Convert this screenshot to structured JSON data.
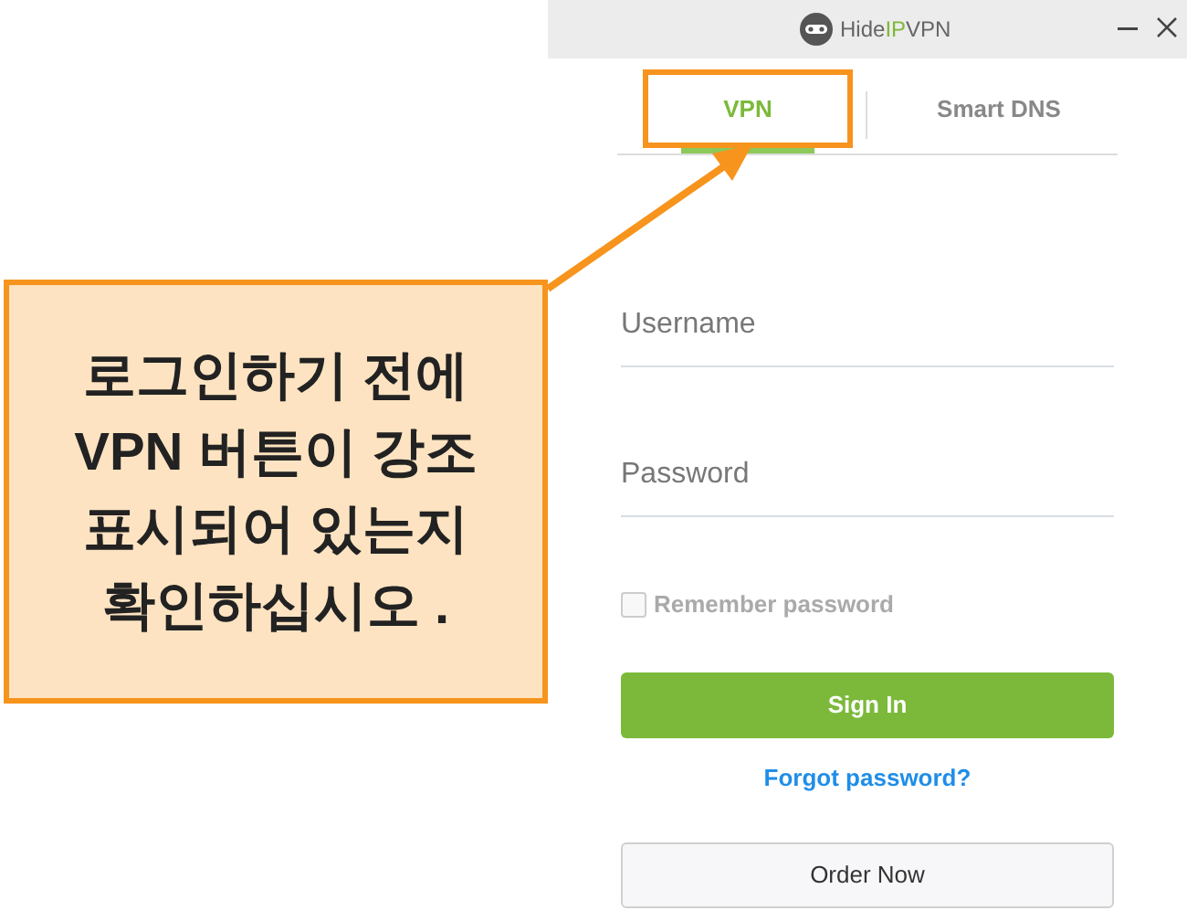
{
  "window": {
    "logo": {
      "before": "Hide",
      "highlight": "IP",
      "after": "VPN"
    }
  },
  "tabs": [
    {
      "label": "VPN",
      "selected": true,
      "highlighted": true
    },
    {
      "label": "Smart DNS",
      "selected": false,
      "highlighted": false
    }
  ],
  "form": {
    "username": {
      "placeholder": "Username"
    },
    "password": {
      "placeholder": "Password"
    },
    "remember": {
      "label": "Remember password",
      "checked": false
    },
    "sign_in": "Sign In",
    "forgot": "Forgot password?",
    "order": "Order Now"
  },
  "callout": {
    "text": "로그인하기 전에\nVPN 버튼이 강조\n표시되어 있는지\n확인하십시오 ."
  }
}
